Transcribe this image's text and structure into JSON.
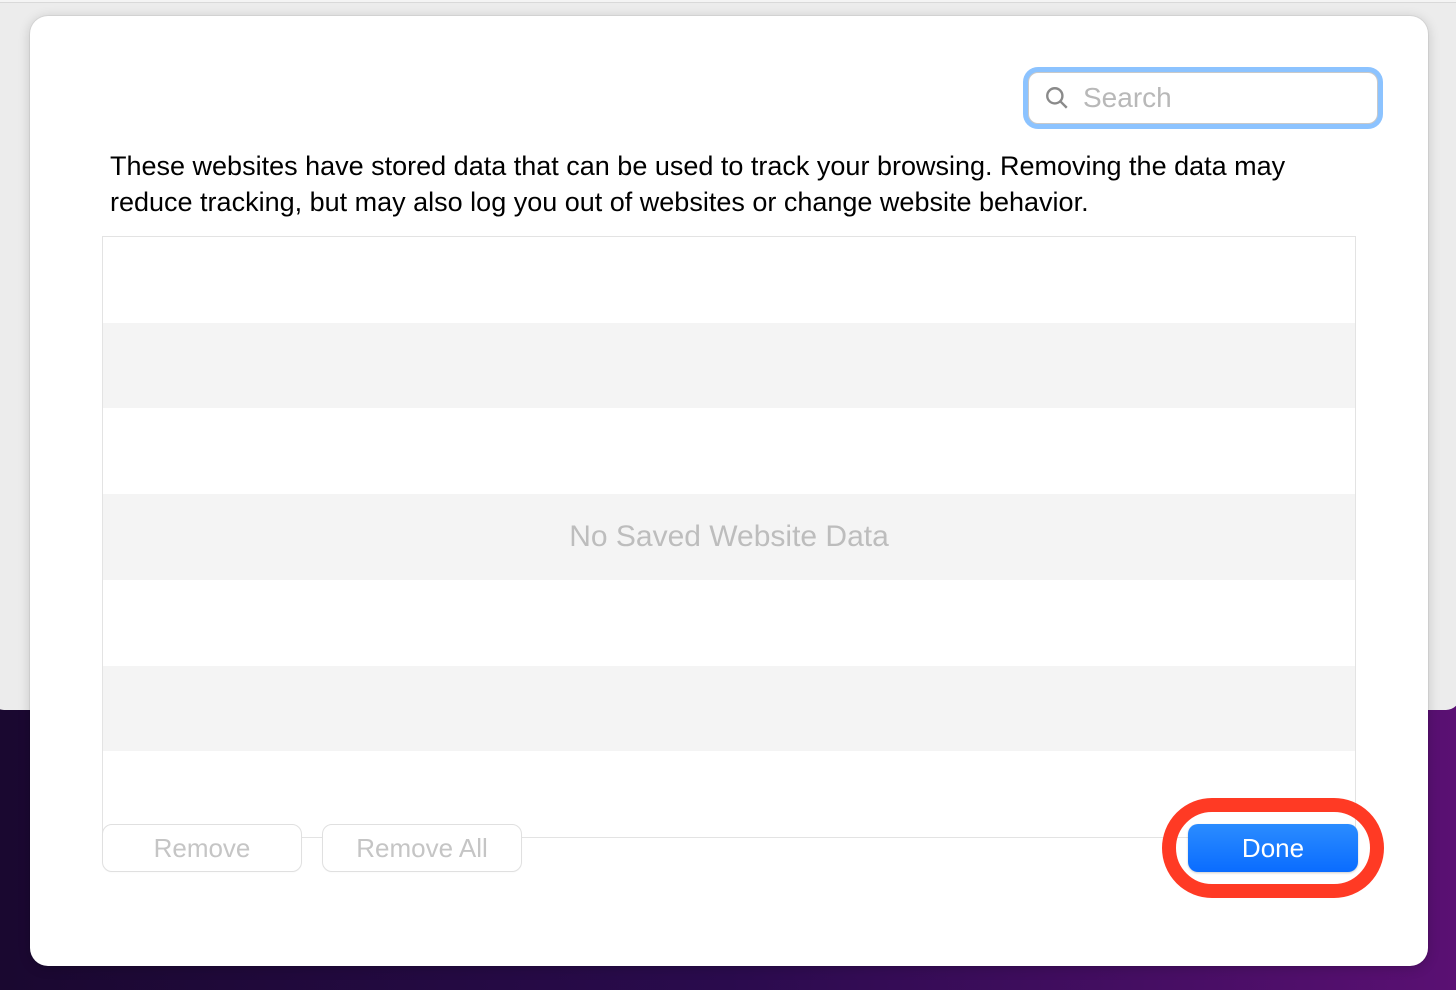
{
  "search": {
    "placeholder": "Search",
    "value": ""
  },
  "description": "These websites have stored data that can be used to track your browsing. Removing the data may reduce tracking, but may also log you out of websites or change website behavior.",
  "list": {
    "empty_text": "No Saved Website Data"
  },
  "buttons": {
    "remove": "Remove",
    "remove_all": "Remove All",
    "done": "Done"
  }
}
